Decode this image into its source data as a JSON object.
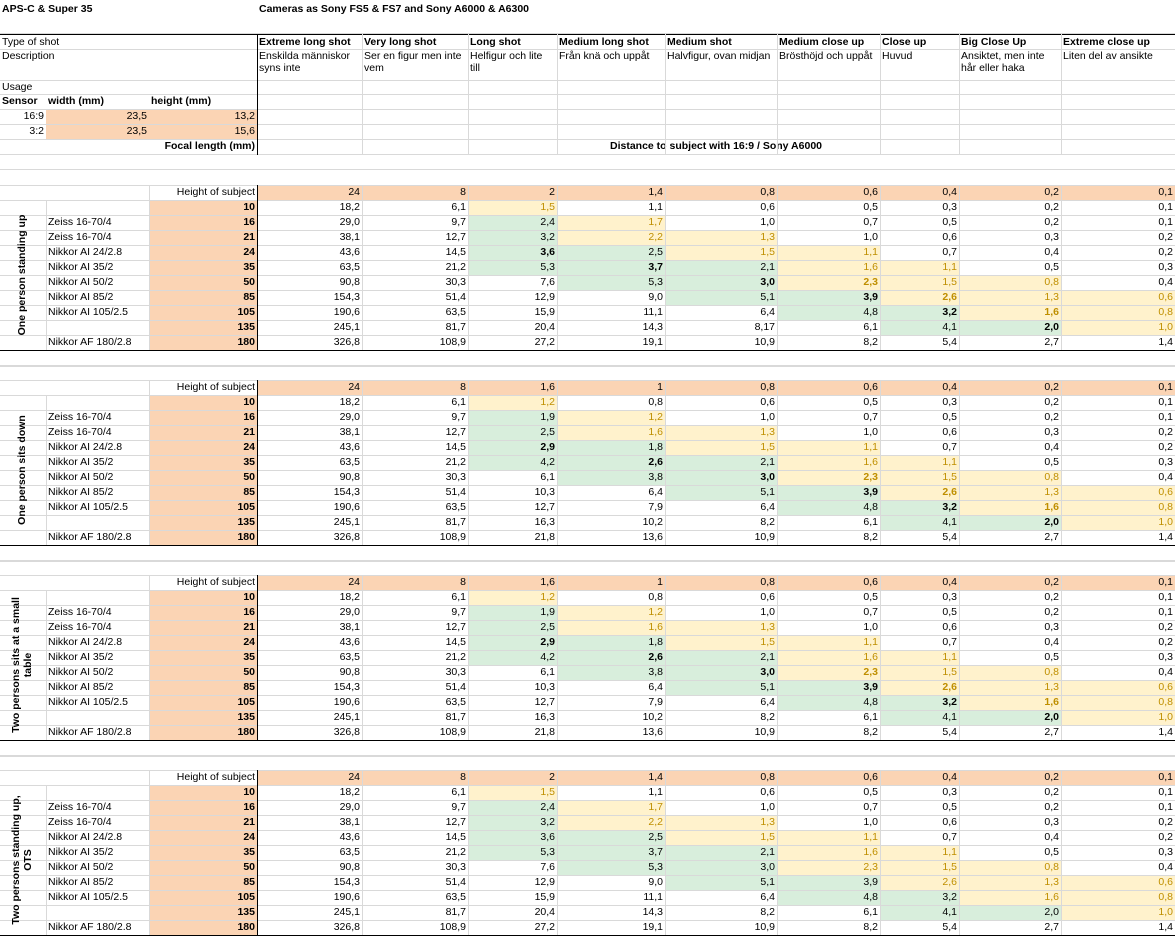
{
  "header": {
    "title_left": "APS-C & Super 35",
    "title_main": "Cameras as Sony FS5 & FS7 and Sony A6000 & A6300"
  },
  "labels": {
    "type_of_shot": "Type of shot",
    "description": "Description",
    "usage": "Usage",
    "sensor": "Sensor",
    "width": "width (mm)",
    "height": "height (mm)",
    "focal_length": "Focal length (mm)",
    "distance_title": "Distance to subject with 16:9 / Sony A6000",
    "height_of_subject": "Height of subject"
  },
  "shots": [
    {
      "name": "Extreme long shot",
      "desc": "Enskilda människor syns inte"
    },
    {
      "name": "Very long shot",
      "desc": "Ser en figur men inte vem"
    },
    {
      "name": "Long shot",
      "desc": "Helfigur och lite till"
    },
    {
      "name": "Medium long shot",
      "desc": "Från knä och uppåt"
    },
    {
      "name": "Medium shot",
      "desc": "Halvfigur, ovan midjan"
    },
    {
      "name": "Medium close up",
      "desc": "Brösthöjd och uppåt"
    },
    {
      "name": "Close up",
      "desc": "Huvud"
    },
    {
      "name": "Big Close Up",
      "desc": "Ansiktet, men inte hår eller haka"
    },
    {
      "name": "Extreme close up",
      "desc": "Liten del av ansikte"
    }
  ],
  "sensors": [
    {
      "ratio": "16:9",
      "width": "23,5",
      "height": "13,2"
    },
    {
      "ratio": "3:2",
      "width": "23,5",
      "height": "15,6"
    }
  ],
  "lenses": [
    "",
    "Zeiss 16-70/4",
    "Zeiss 16-70/4",
    "Nikkor AI 24/2.8",
    "Nikkor AI 35/2",
    "Nikkor AI 50/2",
    "Nikkor AI 85/2",
    "Nikkor AI 105/2.5",
    "",
    "Nikkor AF 180/2.8"
  ],
  "focals": [
    "10",
    "16",
    "21",
    "24",
    "35",
    "50",
    "85",
    "105",
    "135",
    "180"
  ],
  "sections": [
    {
      "label": "One person standing up",
      "heights": [
        "24",
        "8",
        "2",
        "1,4",
        "0,8",
        "0,6",
        "0,4",
        "0,2",
        "0,1"
      ],
      "rows": [
        [
          "18,2",
          "6,1",
          "1,5",
          "1,1",
          "0,6",
          "0,5",
          "0,3",
          "0,2",
          "0,1"
        ],
        [
          "29,0",
          "9,7",
          "2,4",
          "1,7",
          "1,0",
          "0,7",
          "0,5",
          "0,2",
          "0,1"
        ],
        [
          "38,1",
          "12,7",
          "3,2",
          "2,2",
          "1,3",
          "1,0",
          "0,6",
          "0,3",
          "0,2"
        ],
        [
          "43,6",
          "14,5",
          "3,6",
          "2,5",
          "1,5",
          "1,1",
          "0,7",
          "0,4",
          "0,2"
        ],
        [
          "63,5",
          "21,2",
          "5,3",
          "3,7",
          "2,1",
          "1,6",
          "1,1",
          "0,5",
          "0,3"
        ],
        [
          "90,8",
          "30,3",
          "7,6",
          "5,3",
          "3,0",
          "2,3",
          "1,5",
          "0,8",
          "0,4"
        ],
        [
          "154,3",
          "51,4",
          "12,9",
          "9,0",
          "5,1",
          "3,9",
          "2,6",
          "1,3",
          "0,6"
        ],
        [
          "190,6",
          "63,5",
          "15,9",
          "11,1",
          "6,4",
          "4,8",
          "3,2",
          "1,6",
          "0,8"
        ],
        [
          "245,1",
          "81,7",
          "20,4",
          "14,3",
          "8,17",
          "6,1",
          "4,1",
          "2,0",
          "1,0"
        ],
        [
          "326,8",
          "108,9",
          "27,2",
          "19,1",
          "10,9",
          "8,2",
          "5,4",
          "2,7",
          "1,4"
        ]
      ]
    },
    {
      "label": "One person sits down",
      "heights": [
        "24",
        "8",
        "1,6",
        "1",
        "0,8",
        "0,6",
        "0,4",
        "0,2",
        "0,1"
      ],
      "rows": [
        [
          "18,2",
          "6,1",
          "1,2",
          "0,8",
          "0,6",
          "0,5",
          "0,3",
          "0,2",
          "0,1"
        ],
        [
          "29,0",
          "9,7",
          "1,9",
          "1,2",
          "1,0",
          "0,7",
          "0,5",
          "0,2",
          "0,1"
        ],
        [
          "38,1",
          "12,7",
          "2,5",
          "1,6",
          "1,3",
          "1,0",
          "0,6",
          "0,3",
          "0,2"
        ],
        [
          "43,6",
          "14,5",
          "2,9",
          "1,8",
          "1,5",
          "1,1",
          "0,7",
          "0,4",
          "0,2"
        ],
        [
          "63,5",
          "21,2",
          "4,2",
          "2,6",
          "2,1",
          "1,6",
          "1,1",
          "0,5",
          "0,3"
        ],
        [
          "90,8",
          "30,3",
          "6,1",
          "3,8",
          "3,0",
          "2,3",
          "1,5",
          "0,8",
          "0,4"
        ],
        [
          "154,3",
          "51,4",
          "10,3",
          "6,4",
          "5,1",
          "3,9",
          "2,6",
          "1,3",
          "0,6"
        ],
        [
          "190,6",
          "63,5",
          "12,7",
          "7,9",
          "6,4",
          "4,8",
          "3,2",
          "1,6",
          "0,8"
        ],
        [
          "245,1",
          "81,7",
          "16,3",
          "10,2",
          "8,2",
          "6,1",
          "4,1",
          "2,0",
          "1,0"
        ],
        [
          "326,8",
          "108,9",
          "21,8",
          "13,6",
          "10,9",
          "8,2",
          "5,4",
          "2,7",
          "1,4"
        ]
      ]
    },
    {
      "label": "Two persons sits at a small table",
      "heights": [
        "24",
        "8",
        "1,6",
        "1",
        "0,8",
        "0,6",
        "0,4",
        "0,2",
        "0,1"
      ],
      "rows": [
        [
          "18,2",
          "6,1",
          "1,2",
          "0,8",
          "0,6",
          "0,5",
          "0,3",
          "0,2",
          "0,1"
        ],
        [
          "29,0",
          "9,7",
          "1,9",
          "1,2",
          "1,0",
          "0,7",
          "0,5",
          "0,2",
          "0,1"
        ],
        [
          "38,1",
          "12,7",
          "2,5",
          "1,6",
          "1,3",
          "1,0",
          "0,6",
          "0,3",
          "0,2"
        ],
        [
          "43,6",
          "14,5",
          "2,9",
          "1,8",
          "1,5",
          "1,1",
          "0,7",
          "0,4",
          "0,2"
        ],
        [
          "63,5",
          "21,2",
          "4,2",
          "2,6",
          "2,1",
          "1,6",
          "1,1",
          "0,5",
          "0,3"
        ],
        [
          "90,8",
          "30,3",
          "6,1",
          "3,8",
          "3,0",
          "2,3",
          "1,5",
          "0,8",
          "0,4"
        ],
        [
          "154,3",
          "51,4",
          "10,3",
          "6,4",
          "5,1",
          "3,9",
          "2,6",
          "1,3",
          "0,6"
        ],
        [
          "190,6",
          "63,5",
          "12,7",
          "7,9",
          "6,4",
          "4,8",
          "3,2",
          "1,6",
          "0,8"
        ],
        [
          "245,1",
          "81,7",
          "16,3",
          "10,2",
          "8,2",
          "6,1",
          "4,1",
          "2,0",
          "1,0"
        ],
        [
          "326,8",
          "108,9",
          "21,8",
          "13,6",
          "10,9",
          "8,2",
          "5,4",
          "2,7",
          "1,4"
        ]
      ]
    },
    {
      "label": "Two persons standing up, OTS",
      "heights": [
        "24",
        "8",
        "2",
        "1,4",
        "0,8",
        "0,6",
        "0,4",
        "0,2",
        "0,1"
      ],
      "rows": [
        [
          "18,2",
          "6,1",
          "1,5",
          "1,1",
          "0,6",
          "0,5",
          "0,3",
          "0,2",
          "0,1"
        ],
        [
          "29,0",
          "9,7",
          "2,4",
          "1,7",
          "1,0",
          "0,7",
          "0,5",
          "0,2",
          "0,1"
        ],
        [
          "38,1",
          "12,7",
          "3,2",
          "2,2",
          "1,3",
          "1,0",
          "0,6",
          "0,3",
          "0,2"
        ],
        [
          "43,6",
          "14,5",
          "3,6",
          "2,5",
          "1,5",
          "1,1",
          "0,7",
          "0,4",
          "0,2"
        ],
        [
          "63,5",
          "21,2",
          "5,3",
          "3,7",
          "2,1",
          "1,6",
          "1,1",
          "0,5",
          "0,3"
        ],
        [
          "90,8",
          "30,3",
          "7,6",
          "5,3",
          "3,0",
          "2,3",
          "1,5",
          "0,8",
          "0,4"
        ],
        [
          "154,3",
          "51,4",
          "12,9",
          "9,0",
          "5,1",
          "3,9",
          "2,6",
          "1,3",
          "0,6"
        ],
        [
          "190,6",
          "63,5",
          "15,9",
          "11,1",
          "6,4",
          "4,8",
          "3,2",
          "1,6",
          "0,8"
        ],
        [
          "245,1",
          "81,7",
          "20,4",
          "14,3",
          "8,2",
          "6,1",
          "4,1",
          "2,0",
          "1,0"
        ],
        [
          "326,8",
          "108,9",
          "27,2",
          "19,1",
          "10,9",
          "8,2",
          "5,4",
          "2,7",
          "1,4"
        ]
      ]
    }
  ],
  "colors": {
    "orange": "#fbd4b4",
    "yellow": "#fff2cc",
    "yellow_text": "#bf8f00",
    "green": "#d8eedc"
  }
}
